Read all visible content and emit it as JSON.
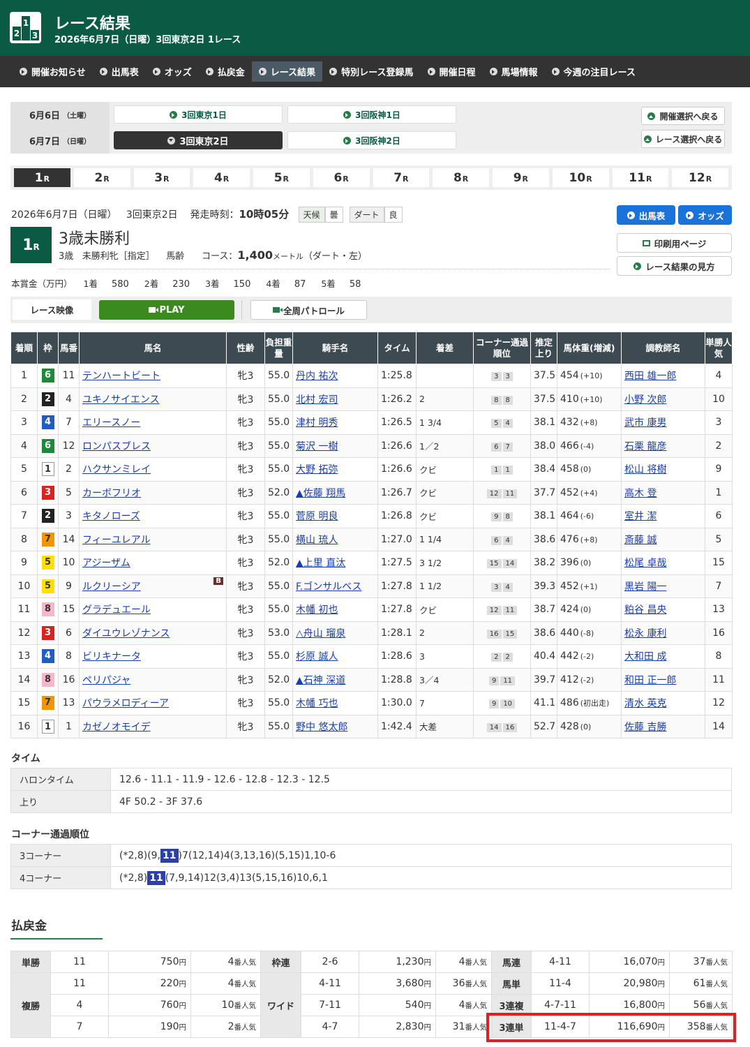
{
  "header": {
    "title": "レース結果",
    "subtitle": "2026年6月7日（日曜）3回東京2日 1レース",
    "logo": [
      "2",
      "1",
      "3"
    ]
  },
  "nav": [
    {
      "label": "開催お知らせ"
    },
    {
      "label": "出馬表"
    },
    {
      "label": "オッズ"
    },
    {
      "label": "払戻金"
    },
    {
      "label": "レース結果",
      "active": true
    },
    {
      "label": "特別レース登録馬"
    },
    {
      "label": "開催日程"
    },
    {
      "label": "馬場情報"
    },
    {
      "label": "今週の注目レース"
    }
  ],
  "days": [
    {
      "date": "6月6日",
      "dow": "（土曜）",
      "meets": [
        "3回東京1日",
        "3回阪神1日"
      ],
      "selected": -1
    },
    {
      "date": "6月7日",
      "dow": "（日曜）",
      "meets": [
        "3回東京2日",
        "3回阪神2日"
      ],
      "selected": 0
    }
  ],
  "side_buttons": [
    "開催選択へ戻る",
    "レース選択へ戻る"
  ],
  "race_tabs": [
    "1",
    "2",
    "3",
    "4",
    "5",
    "6",
    "7",
    "8",
    "9",
    "10",
    "11",
    "12"
  ],
  "race_tab_suffix": "R",
  "race_info": {
    "date": "2026年6月7日（日曜）",
    "meet": "3回東京2日",
    "start_label": "発走時刻：",
    "start": "10時05分",
    "weather_label": "天候",
    "weather": "曇",
    "track_label": "ダート",
    "track": "良",
    "no": "1",
    "no_suffix": "R",
    "name": "3歳未勝利",
    "cond1": "3歳",
    "cond2": "未勝利牝［指定］",
    "cond3": "馬齢",
    "course_label": "コース：",
    "distance": "1,400",
    "distance_unit": "メートル",
    "course": "（ダート・左）"
  },
  "prize": {
    "label": "本賞金（万円）",
    "items": [
      [
        "1着",
        "580"
      ],
      [
        "2着",
        "230"
      ],
      [
        "3着",
        "150"
      ],
      [
        "4着",
        "87"
      ],
      [
        "5着",
        "58"
      ]
    ]
  },
  "buttons": {
    "shutuba": "出馬表",
    "odds": "オッズ",
    "print": "印刷用ページ",
    "howto": "レース結果の見方"
  },
  "video": {
    "label": "レース映像",
    "play": "PLAY",
    "patrol": "全周パトロール"
  },
  "result_headers": [
    "着順",
    "枠",
    "馬番",
    "馬名",
    "性齢",
    "負担重量",
    "騎手名",
    "タイム",
    "着差",
    "コーナー通過順位",
    "推定上り",
    "馬体重(増減)",
    "調教師名",
    "単勝人気"
  ],
  "results": [
    {
      "pos": "1",
      "waku": "6",
      "num": "11",
      "horse": "テンハートビート",
      "sex": "牝3",
      "wt": "55.0",
      "jockey": "丹内 祐次",
      "time": "1:25.8",
      "margin": "",
      "corner": [
        "3",
        "3"
      ],
      "last": "37.5",
      "bw": "454",
      "bwd": "(+10)",
      "trainer": "西田 雄一郎",
      "pop": "4"
    },
    {
      "pos": "2",
      "waku": "2",
      "num": "4",
      "horse": "ユキノサイエンス",
      "sex": "牝3",
      "wt": "55.0",
      "jockey": "北村 宏司",
      "time": "1:26.2",
      "margin": "2",
      "corner": [
        "8",
        "8"
      ],
      "last": "37.5",
      "bw": "410",
      "bwd": "(+10)",
      "trainer": "小野 次郎",
      "pop": "10"
    },
    {
      "pos": "3",
      "waku": "4",
      "num": "7",
      "horse": "エリースノー",
      "sex": "牝3",
      "wt": "55.0",
      "jockey": "津村 明秀",
      "time": "1:26.5",
      "margin": "1 3/4",
      "corner": [
        "5",
        "4"
      ],
      "last": "38.1",
      "bw": "432",
      "bwd": "(+8)",
      "trainer": "武市 康男",
      "pop": "3"
    },
    {
      "pos": "4",
      "waku": "6",
      "num": "12",
      "horse": "ロンパスブレス",
      "sex": "牝3",
      "wt": "55.0",
      "jockey": "菊沢 一樹",
      "time": "1:26.6",
      "margin": "1／2",
      "corner": [
        "6",
        "7"
      ],
      "last": "38.0",
      "bw": "466",
      "bwd": "(-4)",
      "trainer": "石栗 龍彦",
      "pop": "2"
    },
    {
      "pos": "5",
      "waku": "1",
      "num": "2",
      "horse": "ハクサンミレイ",
      "sex": "牝3",
      "wt": "55.0",
      "jockey": "大野 拓弥",
      "time": "1:26.6",
      "margin": "クビ",
      "corner": [
        "1",
        "1"
      ],
      "last": "38.4",
      "bw": "458",
      "bwd": "(0)",
      "trainer": "松山 将樹",
      "pop": "9"
    },
    {
      "pos": "6",
      "waku": "3",
      "num": "5",
      "horse": "カーボフリオ",
      "sex": "牝3",
      "wt": "52.0",
      "jockey": "▲佐藤 翔馬",
      "time": "1:26.7",
      "margin": "クビ",
      "corner": [
        "12",
        "11"
      ],
      "last": "37.7",
      "bw": "452",
      "bwd": "(+4)",
      "trainer": "高木 登",
      "pop": "1"
    },
    {
      "pos": "7",
      "waku": "2",
      "num": "3",
      "horse": "キタノローズ",
      "sex": "牝3",
      "wt": "55.0",
      "jockey": "菅原 明良",
      "time": "1:26.8",
      "margin": "クビ",
      "corner": [
        "9",
        "8"
      ],
      "last": "38.1",
      "bw": "464",
      "bwd": "(-6)",
      "trainer": "室井 潔",
      "pop": "6"
    },
    {
      "pos": "8",
      "waku": "7",
      "num": "14",
      "horse": "フィーユレアル",
      "sex": "牝3",
      "wt": "55.0",
      "jockey": "横山 琉人",
      "time": "1:27.0",
      "margin": "1 1/4",
      "corner": [
        "6",
        "4"
      ],
      "last": "38.6",
      "bw": "476",
      "bwd": "(+8)",
      "trainer": "斎藤 誠",
      "pop": "5"
    },
    {
      "pos": "9",
      "waku": "5",
      "num": "10",
      "horse": "アジーザム",
      "sex": "牝3",
      "wt": "52.0",
      "jockey": "▲上里 直汰",
      "time": "1:27.5",
      "margin": "3 1/2",
      "corner": [
        "15",
        "14"
      ],
      "last": "38.2",
      "bw": "396",
      "bwd": "(0)",
      "trainer": "松尾 卓哉",
      "pop": "15"
    },
    {
      "pos": "10",
      "waku": "5",
      "num": "9",
      "horse": "ルクリーシア",
      "blinker": "B",
      "sex": "牝3",
      "wt": "55.0",
      "jockey": "F.ゴンサルベス",
      "time": "1:27.8",
      "margin": "1 1/2",
      "corner": [
        "3",
        "4"
      ],
      "last": "39.3",
      "bw": "452",
      "bwd": "(+1)",
      "trainer": "黒岩 陽一",
      "pop": "7"
    },
    {
      "pos": "11",
      "waku": "8",
      "num": "15",
      "horse": "グラデュエール",
      "sex": "牝3",
      "wt": "55.0",
      "jockey": "木幡 初也",
      "time": "1:27.8",
      "margin": "クビ",
      "corner": [
        "12",
        "11"
      ],
      "last": "38.7",
      "bw": "424",
      "bwd": "(0)",
      "trainer": "粕谷 昌央",
      "pop": "13"
    },
    {
      "pos": "12",
      "waku": "3",
      "num": "6",
      "horse": "ダイユウレゾナンス",
      "sex": "牝3",
      "wt": "53.0",
      "jockey": "△舟山 瑠泉",
      "time": "1:28.1",
      "margin": "2",
      "corner": [
        "16",
        "15"
      ],
      "last": "38.6",
      "bw": "440",
      "bwd": "(-8)",
      "trainer": "松永 康利",
      "pop": "16"
    },
    {
      "pos": "13",
      "waku": "4",
      "num": "8",
      "horse": "ビリキナータ",
      "sex": "牝3",
      "wt": "55.0",
      "jockey": "杉原 誠人",
      "time": "1:28.6",
      "margin": "3",
      "corner": [
        "2",
        "2"
      ],
      "last": "40.4",
      "bw": "442",
      "bwd": "(-2)",
      "trainer": "大和田 成",
      "pop": "8"
    },
    {
      "pos": "14",
      "waku": "8",
      "num": "16",
      "horse": "ペリパジャ",
      "sex": "牝3",
      "wt": "52.0",
      "jockey": "▲石神 深道",
      "time": "1:28.8",
      "margin": "3／4",
      "corner": [
        "9",
        "11"
      ],
      "last": "39.7",
      "bw": "412",
      "bwd": "(-2)",
      "trainer": "和田 正一郎",
      "pop": "11"
    },
    {
      "pos": "15",
      "waku": "7",
      "num": "13",
      "horse": "パウラメロディーア",
      "sex": "牝3",
      "wt": "55.0",
      "jockey": "木幡 巧也",
      "time": "1:30.0",
      "margin": "7",
      "corner": [
        "9",
        "10"
      ],
      "last": "41.1",
      "bw": "486",
      "bwd": "(初出走)",
      "trainer": "清水 英克",
      "pop": "12"
    },
    {
      "pos": "16",
      "waku": "1",
      "num": "1",
      "horse": "カゼノオモイデ",
      "sex": "牝3",
      "wt": "55.0",
      "jockey": "野中 悠太郎",
      "time": "1:42.4",
      "margin": "大差",
      "corner": [
        "14",
        "16"
      ],
      "last": "52.7",
      "bw": "428",
      "bwd": "(0)",
      "trainer": "佐藤 吉勝",
      "pop": "14"
    }
  ],
  "time": {
    "title": "タイム",
    "rows": [
      {
        "k": "ハロンタイム",
        "v": "12.6 - 11.1 - 11.9 - 12.6 - 12.8 - 12.3 - 12.5"
      },
      {
        "k": "上り",
        "v": "4F 50.2 - 3F 37.6"
      }
    ]
  },
  "corners": {
    "title": "コーナー通過順位",
    "rows": [
      {
        "k": "3コーナー",
        "pre": "(*2,8)(9,",
        "hl": "11",
        "post": ")7(12,14)4(3,13,16)(5,15)1,10-6"
      },
      {
        "k": "4コーナー",
        "pre": "(*2,8)",
        "hl": "11",
        "post": "(7,9,14)12(3,4)13(5,15,16)10,6,1"
      }
    ]
  },
  "payout": {
    "title": "払戻金",
    "yen": "円",
    "pop_suffix": "番人気",
    "tansho": {
      "label": "単勝",
      "rows": [
        [
          "11",
          "750",
          "4"
        ]
      ]
    },
    "fukusho": {
      "label": "複勝",
      "rows": [
        [
          "11",
          "220",
          "4"
        ],
        [
          "4",
          "760",
          "10"
        ],
        [
          "7",
          "190",
          "2"
        ]
      ]
    },
    "wakuren": {
      "label": "枠連",
      "rows": [
        [
          "2-6",
          "1,230",
          "4"
        ]
      ]
    },
    "wide": {
      "label": "ワイド",
      "rows": [
        [
          "4-11",
          "3,680",
          "36"
        ],
        [
          "7-11",
          "540",
          "4"
        ],
        [
          "4-7",
          "2,830",
          "31"
        ]
      ]
    },
    "right": [
      {
        "label": "馬連",
        "c": "4-11",
        "p": "16,070",
        "n": "37"
      },
      {
        "label": "馬単",
        "c": "11-4",
        "p": "20,980",
        "n": "61"
      },
      {
        "label": "3連複",
        "c": "4-7-11",
        "p": "16,800",
        "n": "56"
      },
      {
        "label": "3連単",
        "c": "11-4-7",
        "p": "116,690",
        "n": "358"
      }
    ]
  },
  "colors": {
    "brand": "#0b5a43",
    "nav": "#333333",
    "table_header": "#3e4a52",
    "highlight": "#e02020",
    "accent": "#1a73d8"
  }
}
